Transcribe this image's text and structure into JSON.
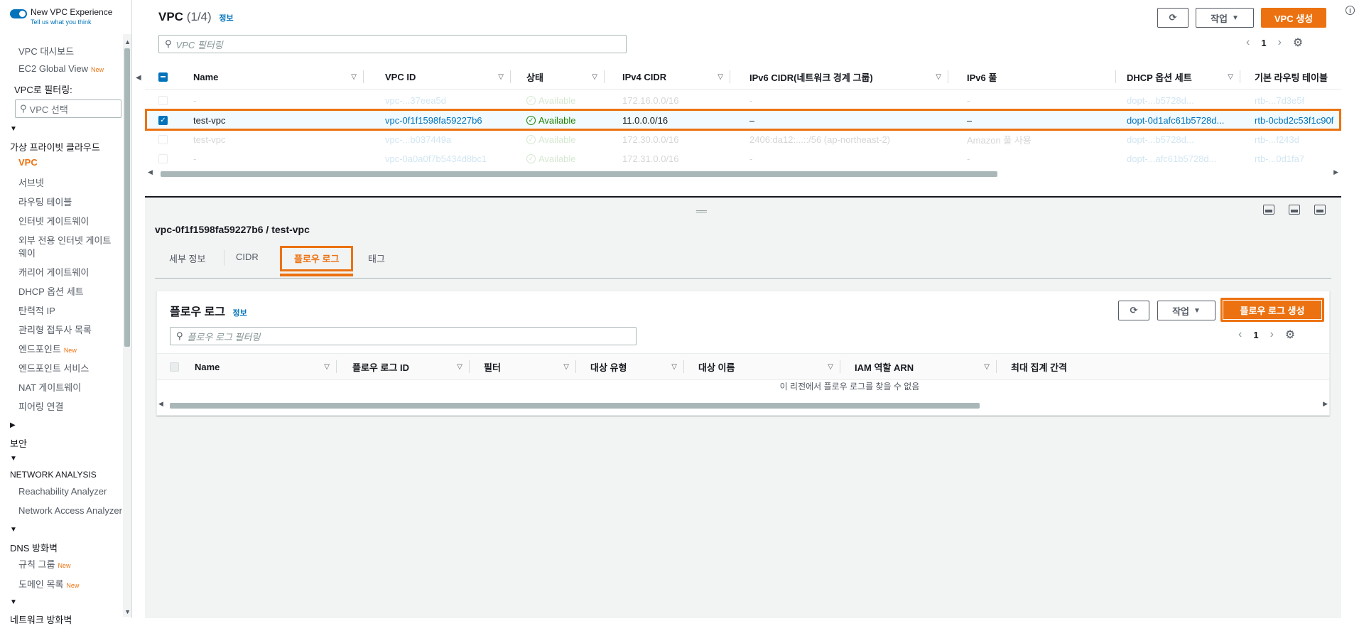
{
  "sidebar": {
    "toggle_title": "New VPC Experience",
    "toggle_sub": "Tell us what you think",
    "new_badge": "New",
    "items_top": [
      {
        "label": "VPC 대시보드"
      },
      {
        "label": "EC2 Global View",
        "badge": "New"
      }
    ],
    "filter_label": "VPC로 필터링:",
    "filter_placeholder": "VPC 선택",
    "section_vpc": "가상 프라이빗 클라우드",
    "vpc_items": [
      {
        "label": "VPC",
        "active": true
      },
      {
        "label": "서브넷"
      },
      {
        "label": "라우팅 테이블"
      },
      {
        "label": "인터넷 게이트웨이"
      },
      {
        "label": "외부 전용 인터넷 게이트"
      },
      {
        "label": "웨이"
      },
      {
        "label": "캐리어 게이트웨이"
      },
      {
        "label": "DHCP 옵션 세트"
      },
      {
        "label": "탄력적 IP"
      },
      {
        "label": "관리형 접두사 목록"
      },
      {
        "label": "엔드포인트",
        "badge": "New"
      },
      {
        "label": "엔드포인트 서비스"
      },
      {
        "label": "NAT 게이트웨이"
      },
      {
        "label": "피어링 연결"
      }
    ],
    "section_security": "보안",
    "section_network_analysis": "NETWORK ANALYSIS",
    "na_items": [
      {
        "label": "Reachability Analyzer"
      },
      {
        "label": "Network Access Analyzer"
      }
    ],
    "section_dns": "DNS 방화벽",
    "dns_items": [
      {
        "label": "규칙 그룹",
        "badge": "New"
      },
      {
        "label": "도메인 목록",
        "badge": "New"
      }
    ],
    "section_network_firewall": "네트워크 방화벽"
  },
  "vpc_panel": {
    "title": "VPC",
    "count": "(1/4)",
    "info": "정보",
    "actions_label": "작업",
    "create_label": "VPC 생성",
    "search_placeholder": "VPC 필터링",
    "page": "1",
    "columns": [
      "Name",
      "VPC ID",
      "상태",
      "IPv4 CIDR",
      "IPv6 CIDR(네트워크 경계 그룹)",
      "IPv6 풀",
      "DHCP 옵션 세트",
      "기본 라우팅 테이블"
    ],
    "rows": [
      {
        "name": "-",
        "vpc_id": "vpc-...37eea5d",
        "status": "Available",
        "ipv4": "172.16.0.0/16",
        "ipv6": "-",
        "pool": "-",
        "dhcp": "dopt-...b5728d...",
        "rtb": "rtb-...7d3e5f"
      },
      {
        "name": "test-vpc",
        "vpc_id": "vpc-0f1f1598fa59227b6",
        "status": "Available",
        "ipv4": "11.0.0.0/16",
        "ipv6": "–",
        "pool": "–",
        "dhcp": "dopt-0d1afc61b5728d...",
        "rtb": "rtb-0cbd2c53f1c90f"
      },
      {
        "name": "test-vpc",
        "vpc_id": "vpc-...b037449a",
        "status": "Available",
        "ipv4": "172.30.0.0/16",
        "ipv6": "2406:da12:...::/56 (ap-northeast-2)",
        "pool": "Amazon 풀 사용",
        "dhcp": "dopt-...b5728d...",
        "rtb": "rtb-...f243d"
      },
      {
        "name": "-",
        "vpc_id": "vpc-0a0a0f7b5434d8bc1",
        "status": "Available",
        "ipv4": "172.31.0.0/16",
        "ipv6": "-",
        "pool": "-",
        "dhcp": "dopt-...afc61b5728d...",
        "rtb": "rtb-...0d1fa7"
      }
    ]
  },
  "detail": {
    "title": "vpc-0f1f1598fa59227b6 / test-vpc",
    "tabs": [
      "세부 정보",
      "CIDR",
      "플로우 로그",
      "태그"
    ],
    "active_tab": "플로우 로그"
  },
  "flow_logs": {
    "title": "플로우 로그",
    "info": "정보",
    "actions_label": "작업",
    "create_label": "플로우 로그 생성",
    "search_placeholder": "플로우 로그 필터링",
    "page": "1",
    "columns": [
      "Name",
      "플로우 로그 ID",
      "필터",
      "대상 유형",
      "대상 이름",
      "IAM 역할 ARN",
      "최대 집계 간격"
    ],
    "empty_text": "이 리전에서 플로우 로그를 찾을 수 없음"
  },
  "colors": {
    "accent": "#ec7211",
    "link": "#0073bb",
    "ok": "#1d8102"
  },
  "icons": [
    "refresh-icon",
    "search-icon",
    "gear-icon",
    "chevron-left-icon",
    "chevron-right-icon",
    "sort-icon",
    "info-icon",
    "check-circle-icon"
  ]
}
